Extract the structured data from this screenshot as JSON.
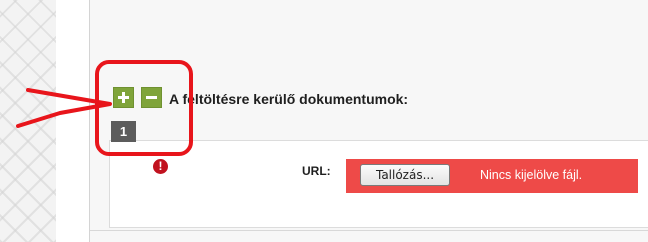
{
  "form": {
    "section_title": "A feltöltésre kerülő dokumentumok:",
    "document_tab": "1",
    "error_icon_glyph": "!",
    "url_label": "URL:",
    "browse_button_label": "Tallózás...",
    "file_status": "Nincs kijelölve fájl."
  },
  "icons": {
    "add": "plus-icon",
    "remove": "minus-icon",
    "error": "exclamation-icon"
  },
  "colors": {
    "button_green": "#7fa43a",
    "tab_gray": "#5c5c5c",
    "file_bar_red": "#ee4a48",
    "error_red": "#c1121f",
    "annotation_red": "#e8151b"
  }
}
